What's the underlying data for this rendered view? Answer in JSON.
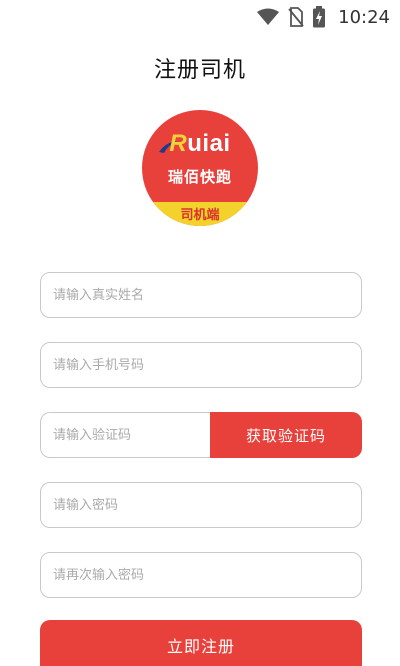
{
  "status_bar": {
    "time": "10:24",
    "icons": [
      "wifi-icon",
      "no-sim-icon",
      "battery-charging-icon"
    ]
  },
  "page": {
    "title": "注册司机"
  },
  "logo": {
    "brand_first": "R",
    "brand_rest": "uiai",
    "brand_cn": "瑞佰快跑",
    "sub_label": "司机端"
  },
  "form": {
    "name_placeholder": "请输入真实姓名",
    "phone_placeholder": "请输入手机号码",
    "code_placeholder": "请输入验证码",
    "code_button_label": "获取验证码",
    "password_placeholder": "请输入密码",
    "password_confirm_placeholder": "请再次输入密码",
    "register_button_label": "立即注册"
  },
  "colors": {
    "accent": "#e8403a",
    "logo_band": "#f3d22c",
    "input_border": "#c9c9c9",
    "placeholder": "#aaaaaa"
  }
}
